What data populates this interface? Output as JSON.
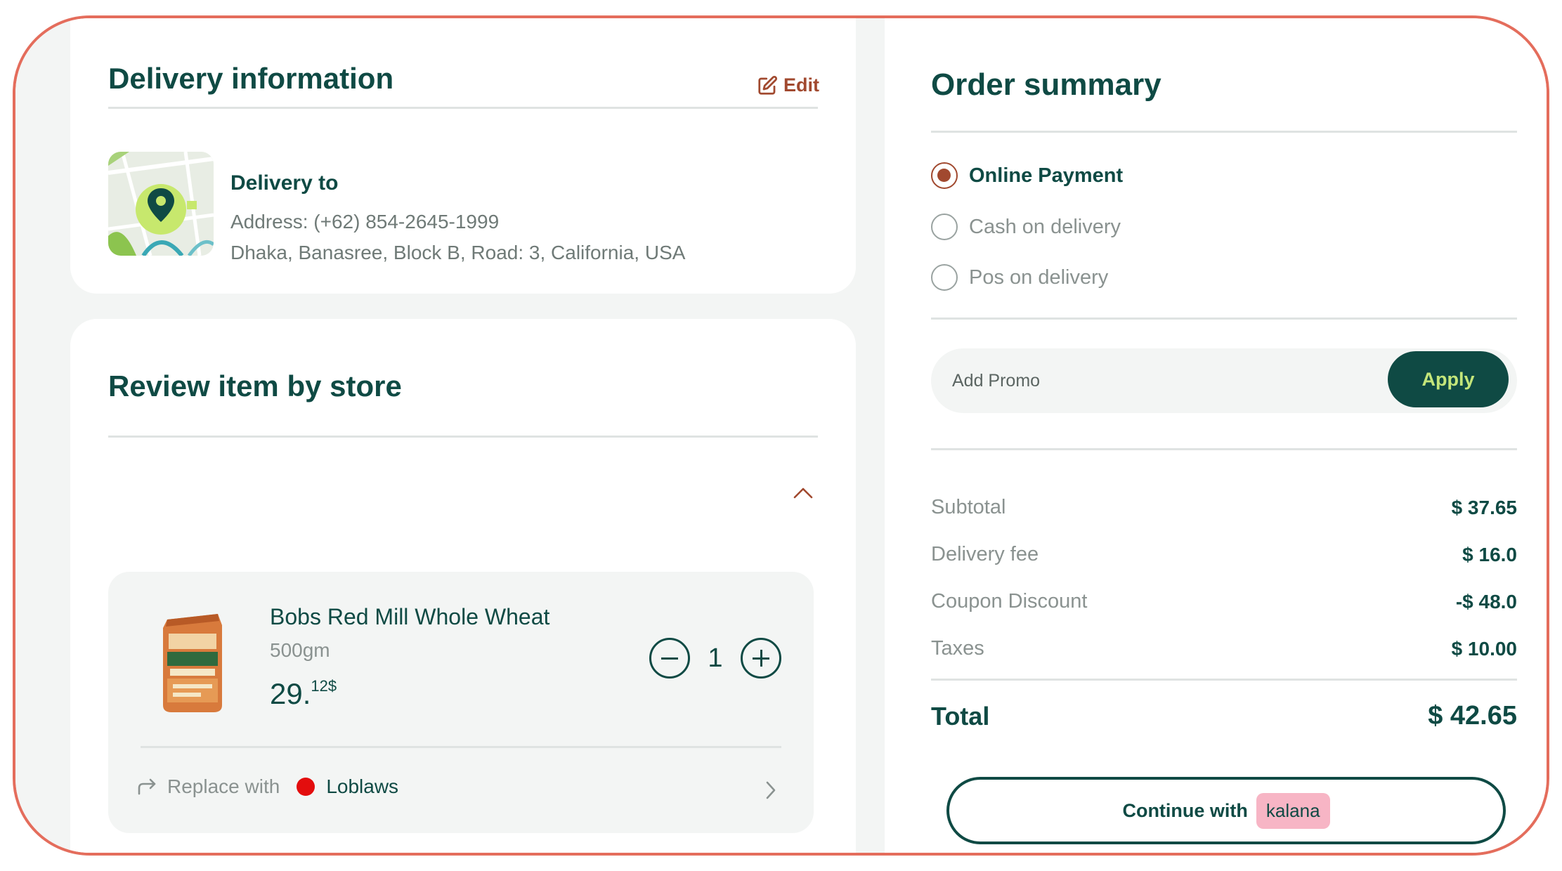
{
  "delivery": {
    "title": "Delivery information",
    "edit_label": "Edit",
    "to_label": "Delivery to",
    "address_line1": "Address: (+62) 854-2645-1999",
    "address_line2": "Dhaka, Banasree, Block B,  Road: 3, California, USA"
  },
  "review": {
    "title": "Review item by store",
    "item": {
      "name": "Bobs Red Mill Whole Wheat",
      "weight": "500gm",
      "price_main": "29.",
      "price_cents": "12$",
      "quantity": "1",
      "replace_label": "Replace with",
      "replace_store": "Loblaws"
    }
  },
  "summary": {
    "title": "Order summary",
    "payment_options": [
      {
        "label": "Online Payment",
        "selected": true
      },
      {
        "label": "Cash on delivery",
        "selected": false
      },
      {
        "label": "Pos on delivery",
        "selected": false
      }
    ],
    "promo_placeholder": "Add Promo",
    "apply_label": "Apply",
    "lines": [
      {
        "label": "Subtotal",
        "value": "$ 37.65"
      },
      {
        "label": "Delivery fee",
        "value": "$ 16.0"
      },
      {
        "label": "Coupon Discount",
        "value": "-$  48.0"
      },
      {
        "label": "Taxes",
        "value": "$ 10.00"
      }
    ],
    "total_label": "Total",
    "total_value": "$ 42.65",
    "continue_label": "Continue with",
    "continue_brand": "kalana"
  },
  "colors": {
    "primary": "#0f4a44",
    "accent": "#a1492f",
    "apply_text": "#c4e67a",
    "frame_border": "#e46d5c",
    "brand_chip": "#f7b5c5",
    "store_dot": "#e30d0d"
  },
  "icons": [
    "edit-icon",
    "map-pin-icon",
    "chevron-up-icon",
    "minus-icon",
    "plus-icon",
    "replace-icon",
    "chevron-right-icon"
  ]
}
